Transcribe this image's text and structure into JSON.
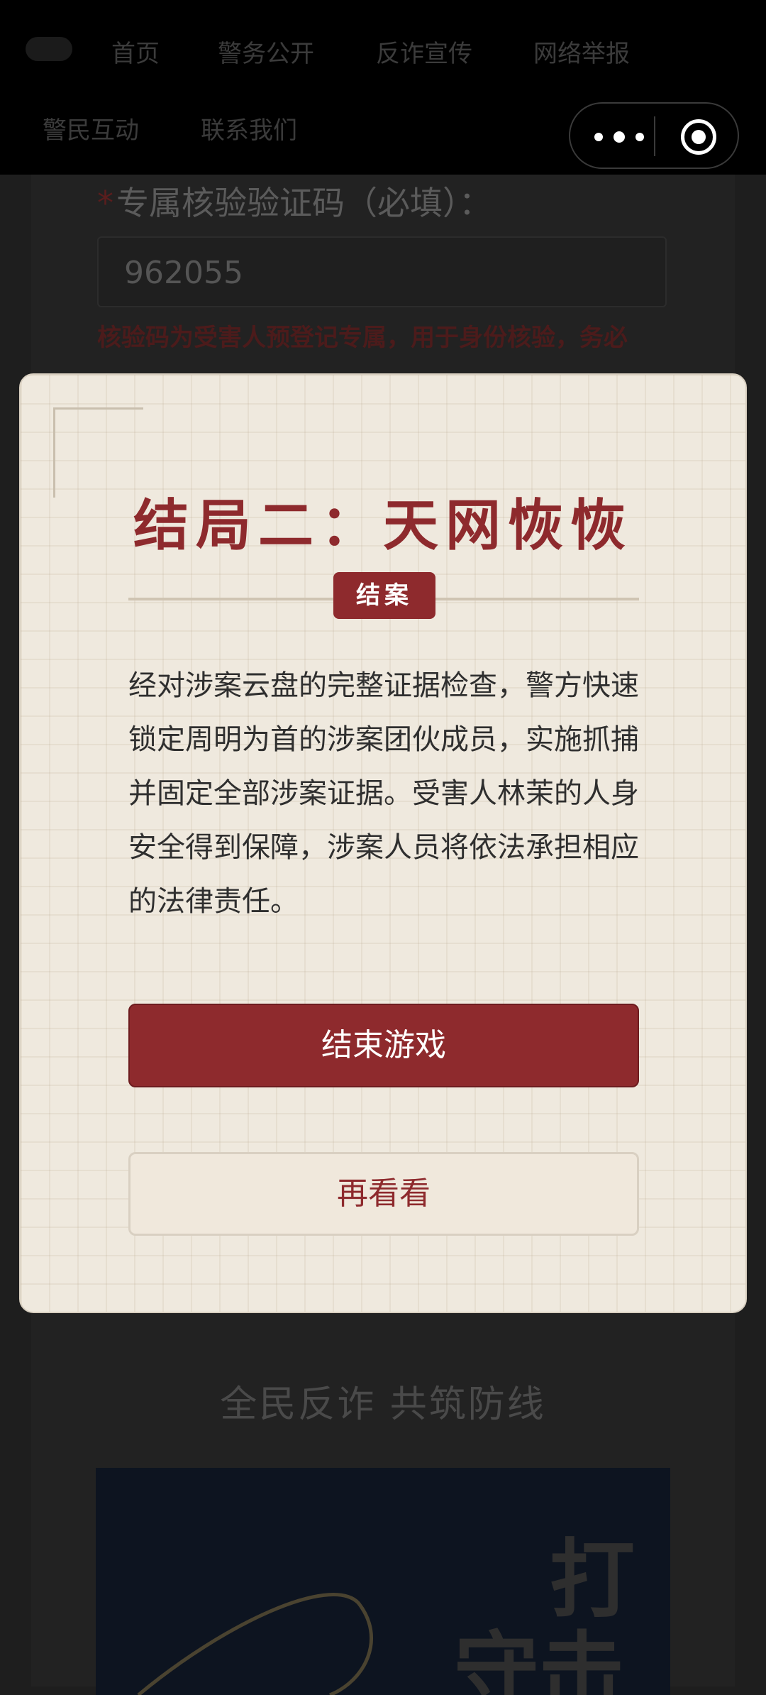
{
  "nav": {
    "items": [
      "首页",
      "警务公开",
      "反诈宣传",
      "网络举报",
      "警民互动",
      "联系我们"
    ]
  },
  "form": {
    "label": "专属核验验证码（必填）：",
    "required_mark": "*",
    "value": "962055",
    "note": "核验码为受害人预登记专属，用于身份核验，务必"
  },
  "modal": {
    "title": "结局二：天网恢恢",
    "badge": "结案",
    "body": "经对涉案云盘的完整证据检查，警方快速锁定周明为首的涉案团伙成员，实施抓捕并固定全部涉案证据。受害人林茉的人身安全得到保障，涉案人员将依法承担相应的法律责任。",
    "primary_button": "结束游戏",
    "secondary_button": "再看看"
  },
  "footer": {
    "slogan": "全民反诈 共筑防线",
    "poster_text": [
      "打",
      "守击"
    ]
  },
  "colors": {
    "accent": "#8e2a2d",
    "modal_bg": "#efe9de",
    "overlay": "#1e1e1e"
  },
  "icons": {
    "capsule_more": "more-dots-icon",
    "capsule_close": "target-close-icon"
  }
}
